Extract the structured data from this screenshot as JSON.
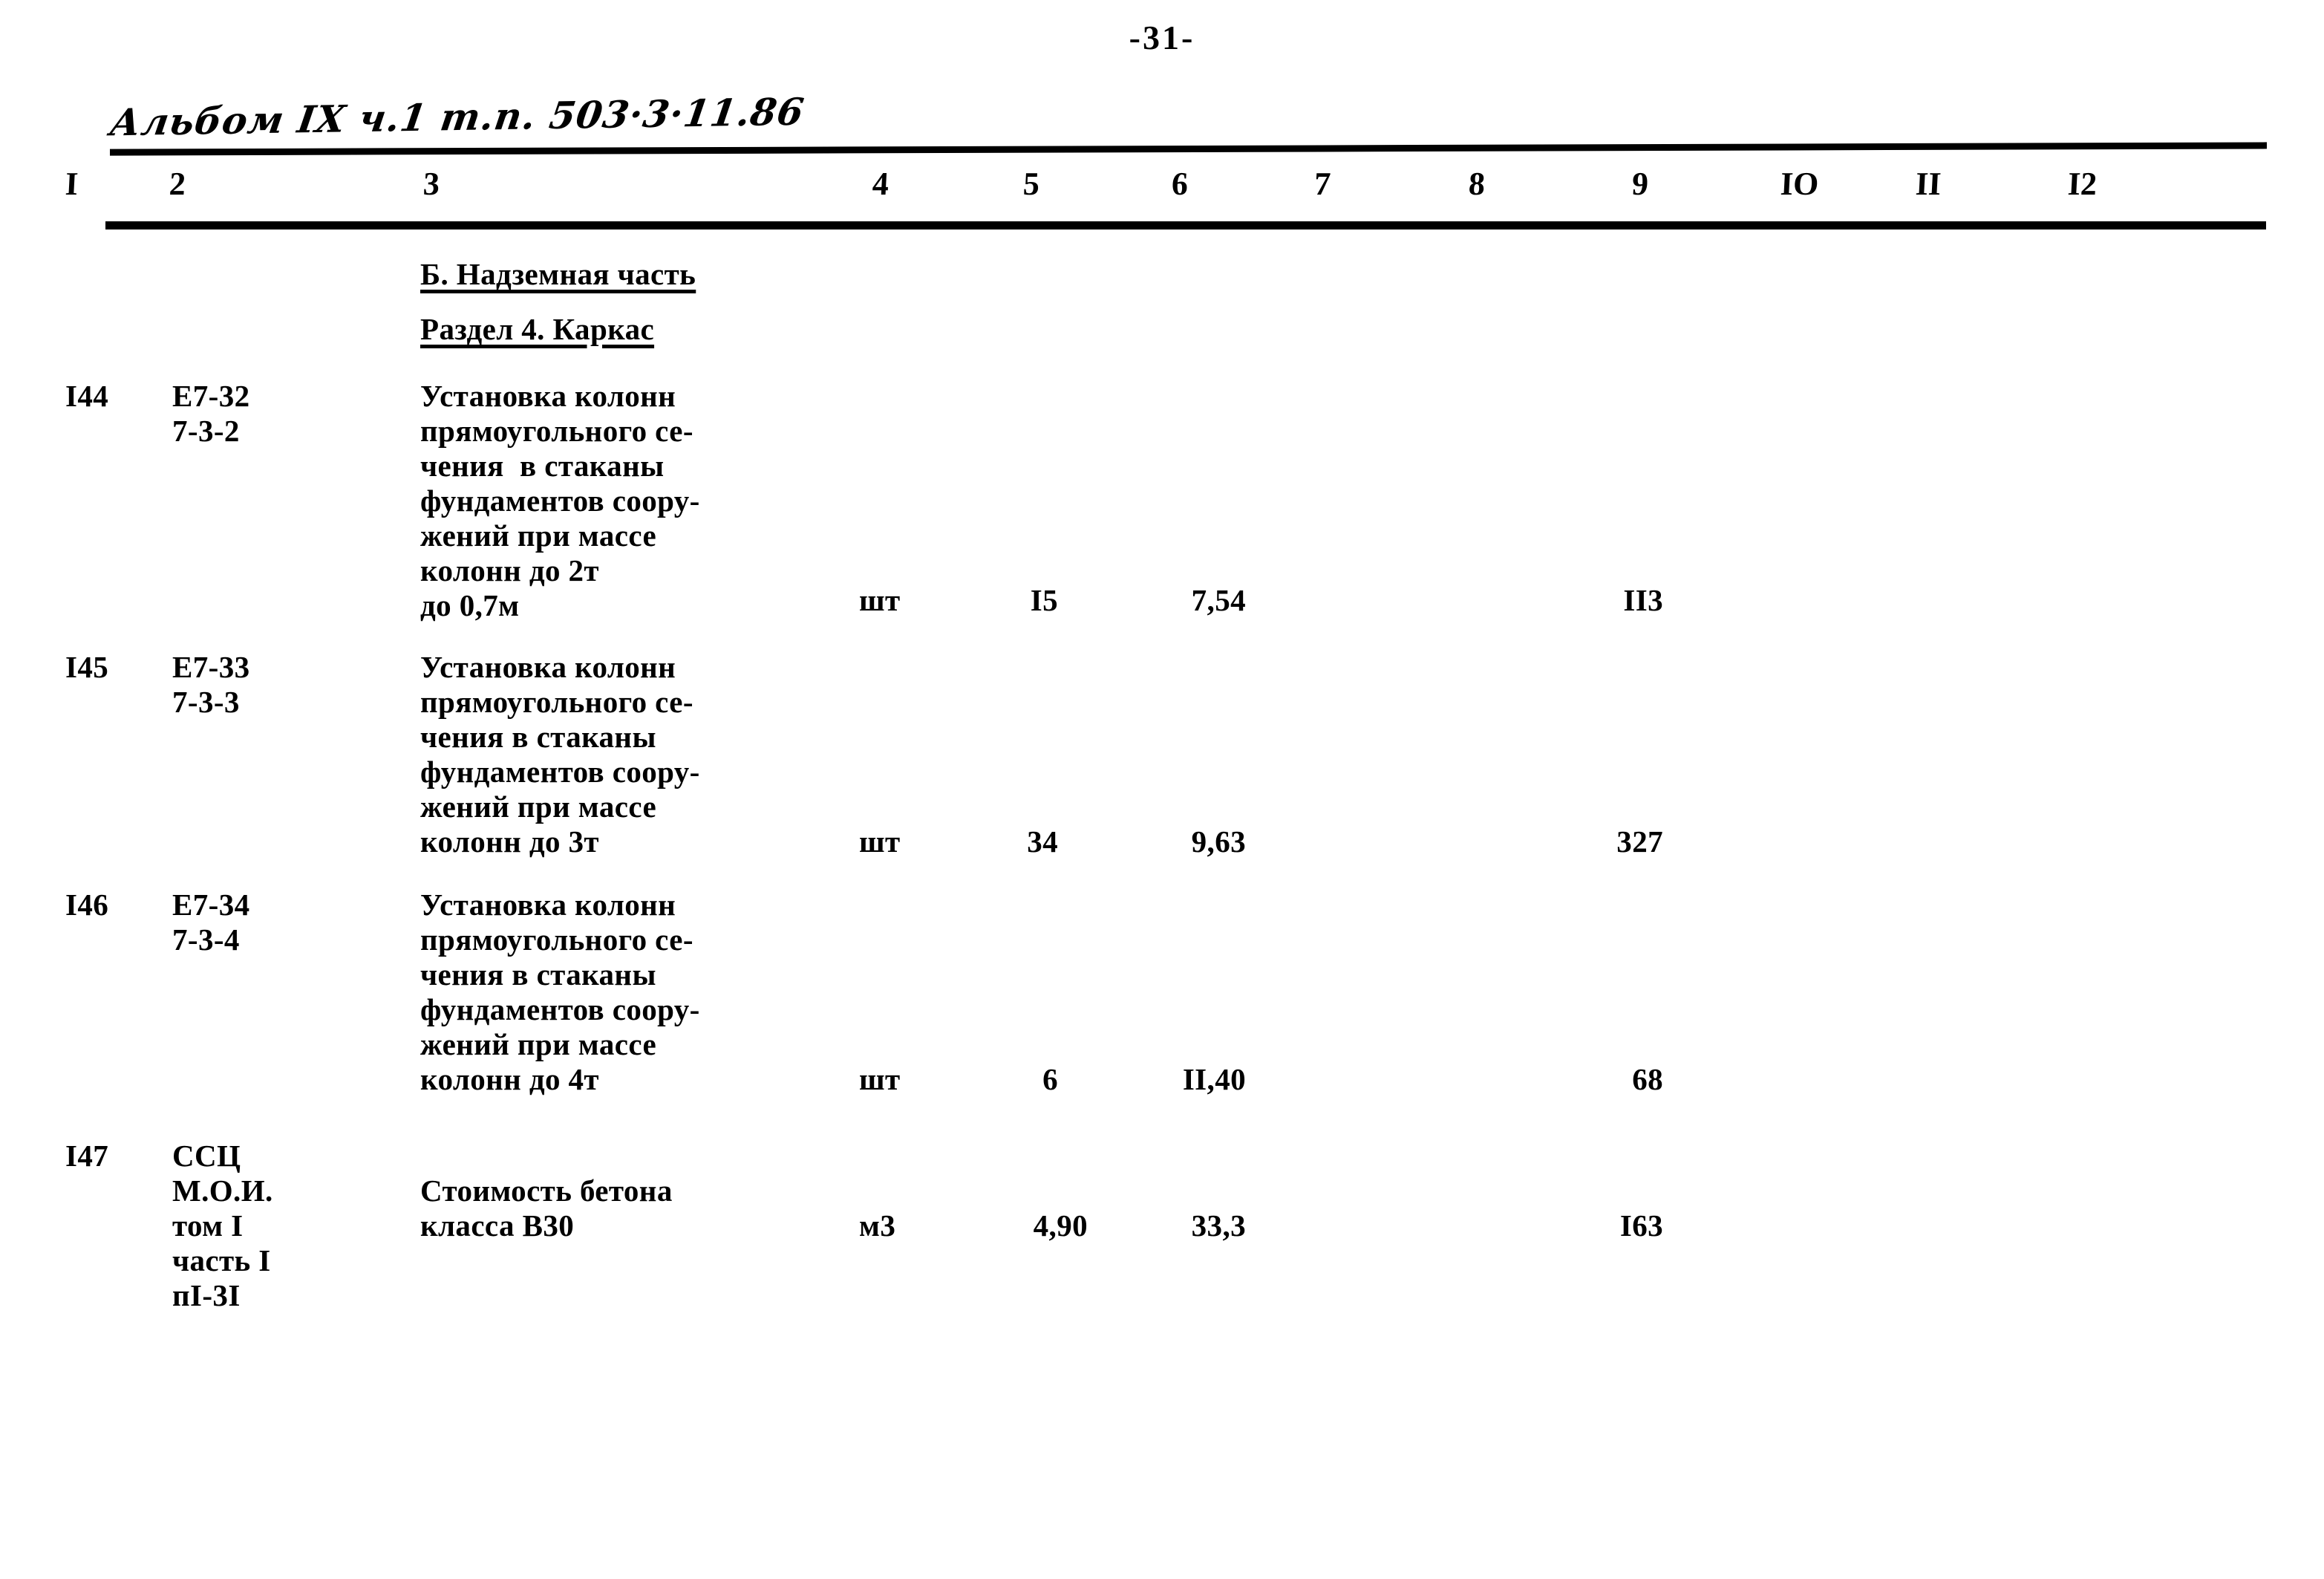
{
  "page": {
    "number_label": "-31-",
    "album_note": "Альбом IX ч.1 т.п. 503·3·11.86"
  },
  "table": {
    "column_headers": [
      "I",
      "2",
      "3",
      "4",
      "5",
      "6",
      "7",
      "8",
      "9",
      "IO",
      "II",
      "I2"
    ],
    "section_headings": [
      {
        "text": "Б. Надземная часть"
      },
      {
        "text": "Раздел 4. Каркас"
      }
    ],
    "rows": [
      {
        "no": "I44",
        "code_lines": [
          "Е7-32",
          "7-3-2"
        ],
        "description_lines": [
          "Установка колонн",
          "прямоугольного се-",
          "чения  в стаканы",
          "фундаментов соору-",
          "жений при массе",
          "колонн до 2т",
          "до 0,7м"
        ],
        "unit": "шт",
        "quantity": "I5",
        "unit_price": "7,54",
        "col7": "",
        "col8": "",
        "total": "II3",
        "col10": "",
        "col11": "",
        "col12": ""
      },
      {
        "no": "I45",
        "code_lines": [
          "Е7-33",
          "7-3-3"
        ],
        "description_lines": [
          "Установка колонн",
          "прямоугольного се-",
          "чения в стаканы",
          "фундаментов соору-",
          "жений при массе",
          "колонн до 3т"
        ],
        "unit": "шт",
        "quantity": "34",
        "unit_price": "9,63",
        "col7": "",
        "col8": "",
        "total": "327",
        "col10": "",
        "col11": "",
        "col12": ""
      },
      {
        "no": "I46",
        "code_lines": [
          "Е7-34",
          "7-3-4"
        ],
        "description_lines": [
          "Установка колонн",
          "прямоугольного се-",
          "чения в стаканы",
          "фундаментов соору-",
          "жений при массе",
          "колонн до 4т"
        ],
        "unit": "шт",
        "quantity": "6",
        "unit_price": "II,40",
        "col7": "",
        "col8": "",
        "total": "68",
        "col10": "",
        "col11": "",
        "col12": ""
      },
      {
        "no": "I47",
        "code_lines": [
          "ССЦ",
          "М.О.И.",
          "том I",
          "часть I",
          "пI-3I"
        ],
        "description_lines": [
          "Стоимость бетона",
          "класса В30"
        ],
        "unit": "м3",
        "quantity": "4,90",
        "unit_price": "33,3",
        "col7": "",
        "col8": "",
        "total": "I63",
        "col10": "",
        "col11": "",
        "col12": ""
      }
    ]
  }
}
